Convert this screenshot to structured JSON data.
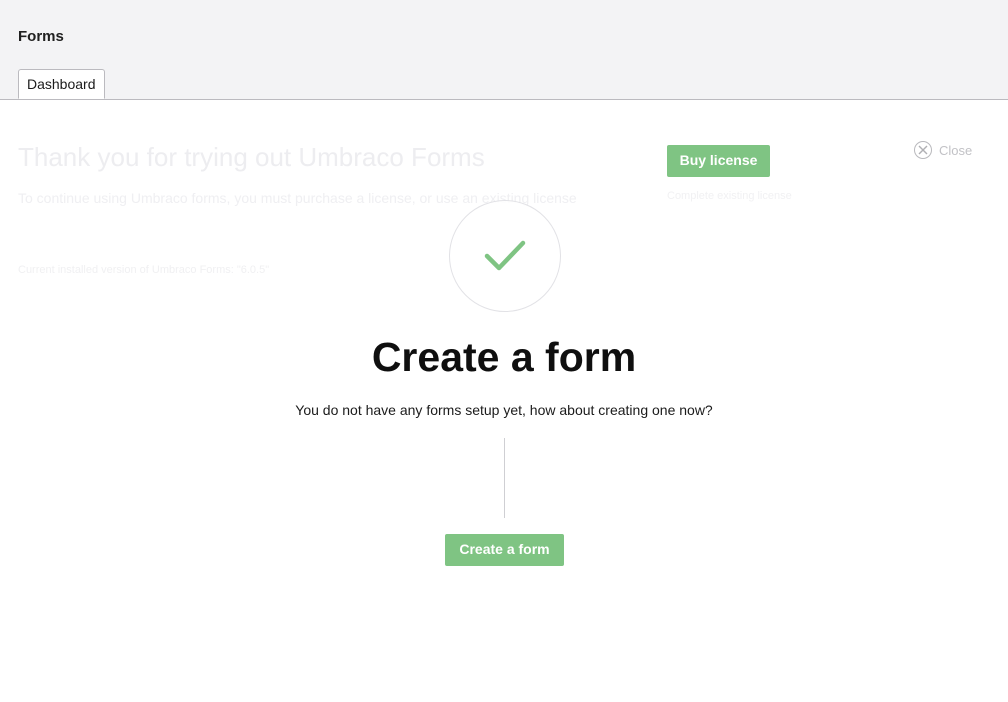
{
  "header": {
    "title": "Forms",
    "tabs": [
      {
        "label": "Dashboard"
      }
    ]
  },
  "trial": {
    "title": "Thank you for trying out Umbraco Forms",
    "description": "To continue using Umbraco forms, you must purchase a license, or use an existing license",
    "version_text": "Current installed version of Umbraco Forms: \"6.0.5\"",
    "buy_label": "Buy license",
    "complete_link": "Complete existing license",
    "close_label": "Close"
  },
  "empty_state": {
    "title": "Create a form",
    "subtitle": "You do not have any forms setup yet, how about creating one now?",
    "button_label": "Create a form"
  },
  "icons": {
    "check": "checkmark-icon",
    "close": "close-circle-icon"
  },
  "colors": {
    "accent_green": "#7fc483",
    "header_bg": "#f3f3f5"
  }
}
